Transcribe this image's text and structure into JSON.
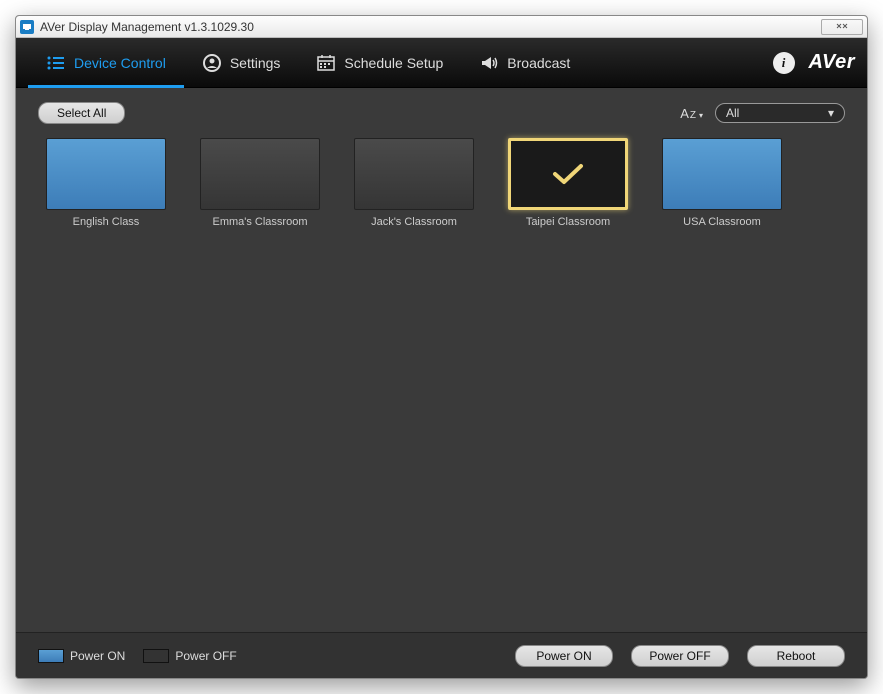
{
  "window": {
    "title": "AVer Display Management v1.3.1029.30"
  },
  "nav": {
    "tabs": [
      {
        "label": "Device Control"
      },
      {
        "label": "Settings"
      },
      {
        "label": "Schedule Setup"
      },
      {
        "label": "Broadcast"
      }
    ],
    "brand": "AVer"
  },
  "toolbar": {
    "select_all": "Select All",
    "sort_label": "AZ",
    "filter_value": "All"
  },
  "devices": [
    {
      "name": "English Class",
      "state": "on",
      "selected": false
    },
    {
      "name": "Emma's Classroom",
      "state": "off",
      "selected": false
    },
    {
      "name": "Jack's Classroom",
      "state": "off",
      "selected": false
    },
    {
      "name": "Taipei Classroom",
      "state": "off",
      "selected": true
    },
    {
      "name": "USA Classroom",
      "state": "on",
      "selected": false
    }
  ],
  "legend": {
    "on": "Power ON",
    "off": "Power OFF"
  },
  "footer": {
    "buttons": [
      {
        "label": "Power ON"
      },
      {
        "label": "Power OFF"
      },
      {
        "label": "Reboot"
      }
    ]
  }
}
